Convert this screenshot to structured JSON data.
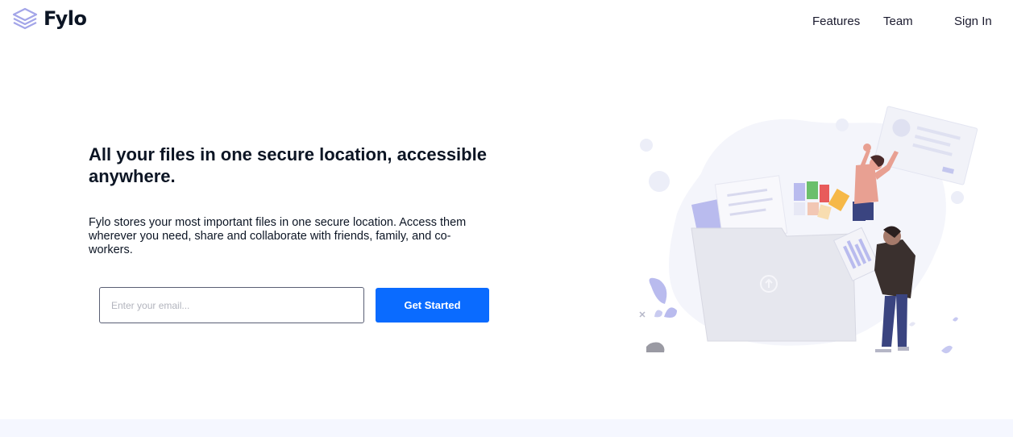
{
  "brand": {
    "name": "Fylo"
  },
  "nav": {
    "features": "Features",
    "team": "Team",
    "sign_in": "Sign In"
  },
  "hero": {
    "title": "All your files in one secure location, accessible anywhere.",
    "description": "Fylo stores your most important files in one secure location. Access them wherever you need, share and collaborate with friends, family, and co-workers.",
    "email_placeholder": "Enter your email...",
    "cta_label": "Get Started"
  },
  "colors": {
    "accent": "#0a6bff",
    "text": "#0c1524",
    "logo": "#a3a5e8",
    "band": "#f5f7ff"
  },
  "icons": {
    "logo": "stacked-layers-icon"
  }
}
